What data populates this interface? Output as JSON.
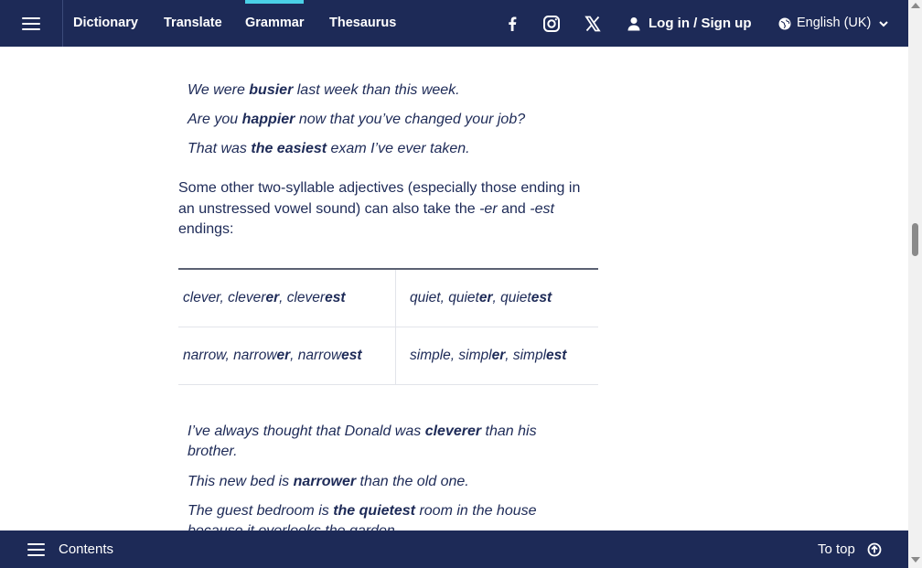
{
  "nav": {
    "links": [
      "Dictionary",
      "Translate",
      "Grammar",
      "Thesaurus"
    ],
    "active": "Grammar",
    "login_label": "Log in / Sign up",
    "language": "English (UK)",
    "social_icons": [
      "facebook-icon",
      "instagram-icon",
      "x-icon"
    ]
  },
  "examples_top": [
    {
      "pre": "We were ",
      "bold": "busier",
      "post": " last week than this week."
    },
    {
      "pre": "Are you ",
      "bold": "happier",
      "post": " now that you’ve changed your job?"
    },
    {
      "pre": "That was ",
      "bold": "the easiest",
      "post": " exam I’ve ever taken."
    }
  ],
  "paragraph": {
    "text1": "Some other two-syllable adjectives (especially those ending in an unstressed vowel sound) can also take the ",
    "er": "-er",
    "and": " and ",
    "est": "-est",
    "text2": " endings:"
  },
  "table": {
    "rows": [
      [
        {
          "w1": "clever, clever",
          "e1": "er",
          "w2": ", clever",
          "e2": "est"
        },
        {
          "w1": "quiet, quiet",
          "e1": "er",
          "w2": ", quiet",
          "e2": "est"
        }
      ],
      [
        {
          "w1": "narrow, narrow",
          "e1": "er",
          "w2": ", narrow",
          "e2": "est"
        },
        {
          "w1": "simple, simpl",
          "e1": "er",
          "w2": ", simpl",
          "e2": "est"
        }
      ]
    ]
  },
  "examples_bottom": [
    {
      "pre": "I’ve always thought that Donald was ",
      "bold": "cleverer",
      "post": " than his brother."
    },
    {
      "pre": "This new bed is ",
      "bold": "narrower",
      "post": " than the old one."
    },
    {
      "pre": "The guest bedroom is ",
      "bold": "the quietest",
      "post": " room in the house because it overlooks the garden."
    }
  ],
  "bottom": {
    "contents_label": "Contents",
    "totop_label": "To top"
  },
  "colors": {
    "navy": "#1d2a57",
    "accent": "#4ad0e6"
  }
}
